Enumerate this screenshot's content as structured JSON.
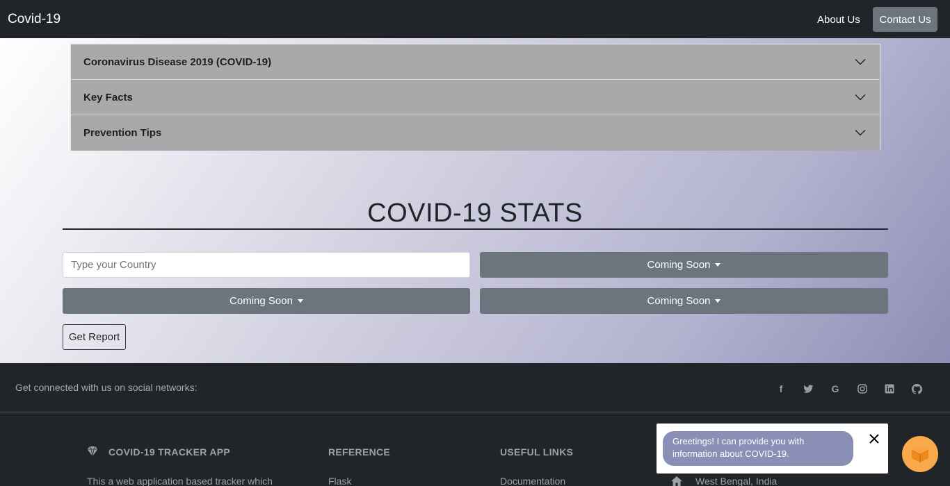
{
  "navbar": {
    "brand": "Covid-19",
    "links": {
      "about": "About Us",
      "contact": "Contact Us"
    }
  },
  "accordion": {
    "items": [
      {
        "title": "Coronavirus Disease 2019 (COVID-19)"
      },
      {
        "title": "Key Facts"
      },
      {
        "title": "Prevention Tips"
      }
    ]
  },
  "stats": {
    "title": "COVID-19 STATS",
    "country_placeholder": "Type your Country",
    "dropdowns": [
      "Coming Soon",
      "Coming Soon",
      "Coming Soon"
    ],
    "report_button": "Get Report"
  },
  "footer": {
    "social_text": "Get connected with us on social networks:",
    "social_icons": [
      "facebook-icon",
      "twitter-icon",
      "google-icon",
      "instagram-icon",
      "linkedin-icon",
      "github-icon"
    ],
    "columns": [
      {
        "heading": "COVID-19 TRACKER APP",
        "text": "This a web application based tracker which"
      },
      {
        "heading": "REFERENCE",
        "text": "Flask"
      },
      {
        "heading": "USEFUL LINKS",
        "text": "Documentation"
      },
      {
        "heading": "",
        "text": "West Bengal, India"
      }
    ]
  },
  "chatbot": {
    "greeting": "Greetings! I can provide you with information about COVID-19."
  },
  "colors": {
    "navbar_bg": "#212529",
    "accordion_bg": "#a9a9a9",
    "button_secondary": "#6c757d",
    "chat_bubble": "#8a8fb6",
    "chat_fab": "#f7a94b"
  }
}
